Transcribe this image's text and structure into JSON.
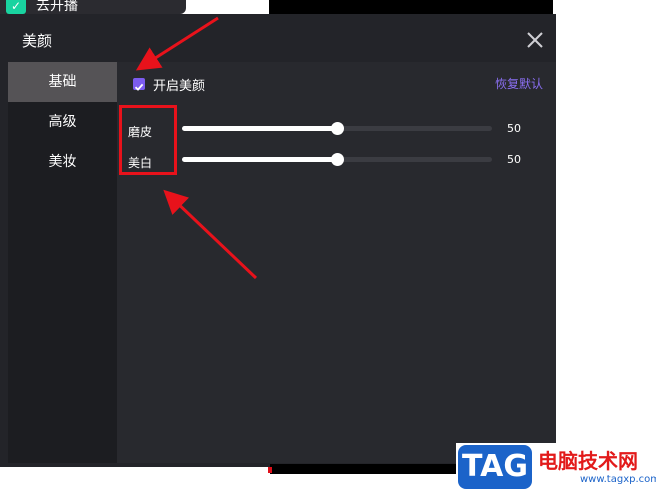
{
  "top_bar": {
    "go_live_label": "去开播"
  },
  "dialog": {
    "title": "美颜",
    "sidebar": [
      {
        "label": "基础",
        "active": true
      },
      {
        "label": "高级",
        "active": false
      },
      {
        "label": "美妆",
        "active": false
      }
    ],
    "content": {
      "enable_label": "开启美颜",
      "enable_checked": true,
      "reset_label": "恢复默认",
      "sliders": [
        {
          "label": "磨皮",
          "value": "50",
          "fraction": 0.5
        },
        {
          "label": "美白",
          "value": "50",
          "fraction": 0.5
        }
      ]
    }
  },
  "watermark": {
    "logo_text": "TAG",
    "title": "电脑技术网",
    "url": "www.tagxp.com"
  },
  "colors": {
    "accent": "#7c5cf0",
    "annotation": "#e8121b",
    "panel": "#28292e",
    "sidebar": "#1c1d21"
  }
}
